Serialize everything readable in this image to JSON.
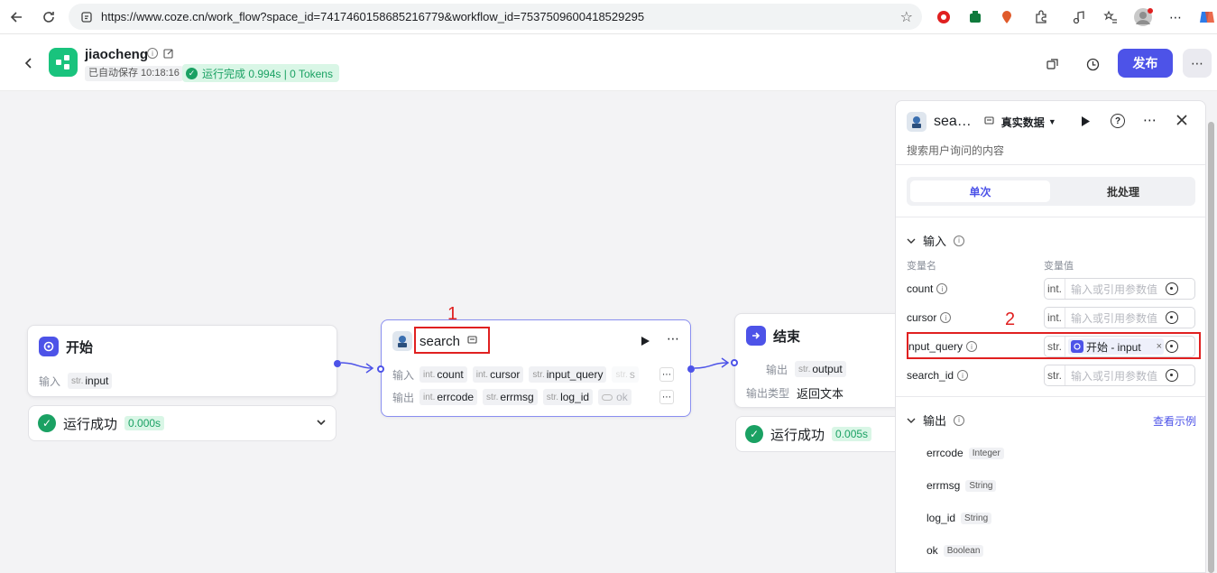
{
  "browser": {
    "url": "https://www.coze.cn/work_flow?space_id=7417460158685216779&workflow_id=7537509600418529295"
  },
  "header": {
    "app_name": "jiaocheng",
    "saved_text": "已自动保存 10:18:16",
    "run_status": "运行完成 0.994s | 0 Tokens",
    "publish_label": "发布"
  },
  "start_node": {
    "title": "开始",
    "input_label": "输入",
    "input_type": "str.",
    "input_name": "input",
    "status_text": "运行成功",
    "status_time": "0.000s"
  },
  "search_node": {
    "annotation_number": "1",
    "title": "search",
    "input_label": "输入",
    "output_label": "输出",
    "inputs": [
      {
        "type": "int.",
        "name": "count"
      },
      {
        "type": "int.",
        "name": "cursor"
      },
      {
        "type": "str.",
        "name": "input_query"
      },
      {
        "type": "str.",
        "name": "s"
      }
    ],
    "outputs": [
      {
        "type": "int.",
        "name": "errcode"
      },
      {
        "type": "str.",
        "name": "errmsg"
      },
      {
        "type": "str.",
        "name": "log_id"
      },
      {
        "type": "",
        "name": "ok"
      }
    ]
  },
  "end_node": {
    "title": "结束",
    "output_label": "输出",
    "output_type": "str.",
    "output_name": "output",
    "output_kind_label": "输出类型",
    "output_kind_value": "返回文本",
    "status_text": "运行成功",
    "status_time": "0.005s"
  },
  "panel": {
    "title": "sea…",
    "data_mode": "真实数据",
    "description": "搜索用户询问的内容",
    "tab_single": "单次",
    "tab_batch": "批处理",
    "input_section": "输入",
    "col_var_name": "变量名",
    "col_var_value": "变量值",
    "placeholder": "输入或引用参数值",
    "annotation_number": "2",
    "inputs": [
      {
        "name": "count",
        "type": "int."
      },
      {
        "name": "cursor",
        "type": "int."
      },
      {
        "name": "nput_query",
        "type": "str.",
        "ref": "开始 - input"
      },
      {
        "name": "search_id",
        "type": "str."
      }
    ],
    "output_section": "输出",
    "view_example": "查看示例",
    "outputs": [
      {
        "name": "errcode",
        "type": "Integer"
      },
      {
        "name": "errmsg",
        "type": "String"
      },
      {
        "name": "log_id",
        "type": "String"
      },
      {
        "name": "ok",
        "type": "Boolean"
      }
    ]
  },
  "colors": {
    "accent": "#4d53e8",
    "success": "#1aa163",
    "annotation": "#e02020"
  }
}
